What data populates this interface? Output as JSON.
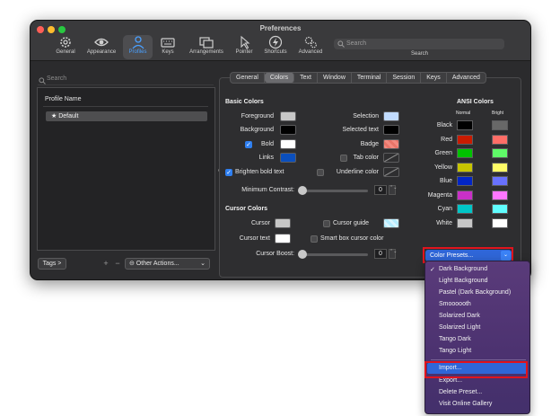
{
  "window": {
    "title": "Preferences",
    "traffic_colors": [
      "#ff5f57",
      "#febc2e",
      "#28c840"
    ]
  },
  "toolbar": {
    "items": [
      {
        "label": "General",
        "icon": "gear-icon"
      },
      {
        "label": "Appearance",
        "icon": "eye-icon"
      },
      {
        "label": "Profiles",
        "icon": "person-icon"
      },
      {
        "label": "Keys",
        "icon": "keyboard-icon"
      },
      {
        "label": "Arrangements",
        "icon": "windows-icon"
      },
      {
        "label": "Pointer",
        "icon": "pointer-icon"
      },
      {
        "label": "Shortcuts",
        "icon": "bolt-icon"
      },
      {
        "label": "Advanced",
        "icon": "gears-icon"
      }
    ],
    "search_placeholder": "Search",
    "search_label": "Search"
  },
  "left": {
    "search_placeholder": "Search",
    "profile_header": "Profile Name",
    "profiles": [
      "★ Default"
    ],
    "tags_label": "Tags >",
    "plus": "+",
    "minus": "−",
    "other_actions": "⊝ Other Actions...",
    "other_chevron": "⌄"
  },
  "tabs": [
    "General",
    "Colors",
    "Text",
    "Window",
    "Terminal",
    "Session",
    "Keys",
    "Advanced"
  ],
  "colors": {
    "basic_title": "Basic Colors",
    "foreground": {
      "label": "Foreground",
      "color": "#c7c7c7"
    },
    "background": {
      "label": "Background",
      "color": "#000000"
    },
    "bold": {
      "label": "Bold",
      "color": "#ffffff"
    },
    "links": {
      "label": "Links",
      "color": "#0b4fbd"
    },
    "brighten": "Brighten bold text",
    "selection": {
      "label": "Selection",
      "color": "#c2dcff"
    },
    "selected_text": {
      "label": "Selected text",
      "color": "#000000"
    },
    "badge": {
      "label": "Badge",
      "color": "#f28a80"
    },
    "tab_color": "Tab color",
    "underline_color": "Underline color",
    "min_contrast": {
      "label": "Minimum Contrast:",
      "value": "0",
      "stepper": "⌃⌄"
    },
    "cursor_title": "Cursor Colors",
    "cursor": {
      "label": "Cursor",
      "color": "#c7c7c7"
    },
    "cursor_text": {
      "label": "Cursor text",
      "color": "#ffffff"
    },
    "cursor_guide": {
      "label": "Cursor guide",
      "color": "#b3ecff"
    },
    "smart_box": "Smart box cursor color",
    "cursor_boost": {
      "label": "Cursor Boost:",
      "value": "0",
      "stepper": "⌃⌄"
    }
  },
  "ansi": {
    "title": "ANSI Colors",
    "normal": "Normal",
    "bright": "Bright",
    "rows": [
      {
        "name": "Black",
        "normal": "#000000",
        "bright": "#686868"
      },
      {
        "name": "Red",
        "normal": "#c91b00",
        "bright": "#ff6e67"
      },
      {
        "name": "Green",
        "normal": "#00c200",
        "bright": "#5ffa68"
      },
      {
        "name": "Yellow",
        "normal": "#c7c400",
        "bright": "#fffc67"
      },
      {
        "name": "Blue",
        "normal": "#0225c7",
        "bright": "#6871ff"
      },
      {
        "name": "Magenta",
        "normal": "#c930c7",
        "bright": "#ff77ff"
      },
      {
        "name": "Cyan",
        "normal": "#00c5c7",
        "bright": "#60fdff"
      },
      {
        "name": "White",
        "normal": "#c7c7c7",
        "bright": "#ffffff"
      }
    ]
  },
  "presets": {
    "button_label": "Color Presets...",
    "arrow": "⌄",
    "menu_check": "✓",
    "menu_items": [
      "Dark Background",
      "Light Background",
      "Pastel (Dark Background)",
      "Smoooooth",
      "Solarized Dark",
      "Solarized Light",
      "Tango Dark",
      "Tango Light"
    ],
    "action_items": [
      "Import...",
      "Export...",
      "Delete Preset...",
      "Visit Online Gallery"
    ],
    "highlight_color": "#e0141e"
  }
}
